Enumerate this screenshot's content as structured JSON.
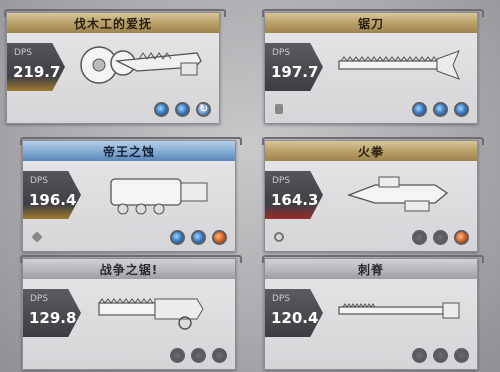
{
  "cards": [
    {
      "title": "伐木工的爱抚",
      "dps_label": "DPS",
      "dps": "219.7"
    },
    {
      "title": "锯刀",
      "dps_label": "DPS",
      "dps": "197.7"
    },
    {
      "title": "帝王之蚀",
      "dps_label": "DPS",
      "dps": "196.4"
    },
    {
      "title": "火拳",
      "dps_label": "DPS",
      "dps": "164.3"
    },
    {
      "title": "战争之锯!",
      "dps_label": "DPS",
      "dps": "129.8"
    },
    {
      "title": "刺脊",
      "dps_label": "DPS",
      "dps": "120.4"
    }
  ],
  "colors": {
    "gold_header": "#b59d63",
    "blue_header": "#7fa6cf",
    "gray_header": "#b5b5b9",
    "dps_panel": "#3c3c42",
    "slot_blue": "#2f78c2",
    "slot_orange": "#d45d1c"
  }
}
